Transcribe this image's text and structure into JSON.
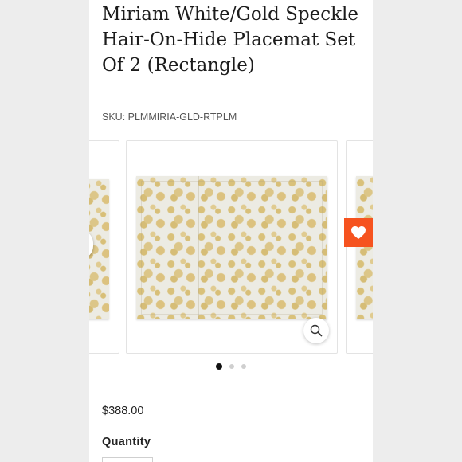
{
  "product": {
    "title": "Miriam White/Gold Speckle Hair-On-Hide Placemat Set Of 2 (Rectangle)",
    "sku": "SKU: PLMMIRIA-GLD-RTPLM",
    "price": "$388.00"
  },
  "gallery": {
    "active_index": 0,
    "image_count": 3
  },
  "quantity": {
    "label": "Quantity"
  },
  "icons": {
    "zoom": "magnifier-icon",
    "favorite": "heart-icon"
  },
  "colors": {
    "favorite_bg": "#f6531f",
    "dot_active": "#111111",
    "dot_inactive": "#cfcfcf"
  }
}
